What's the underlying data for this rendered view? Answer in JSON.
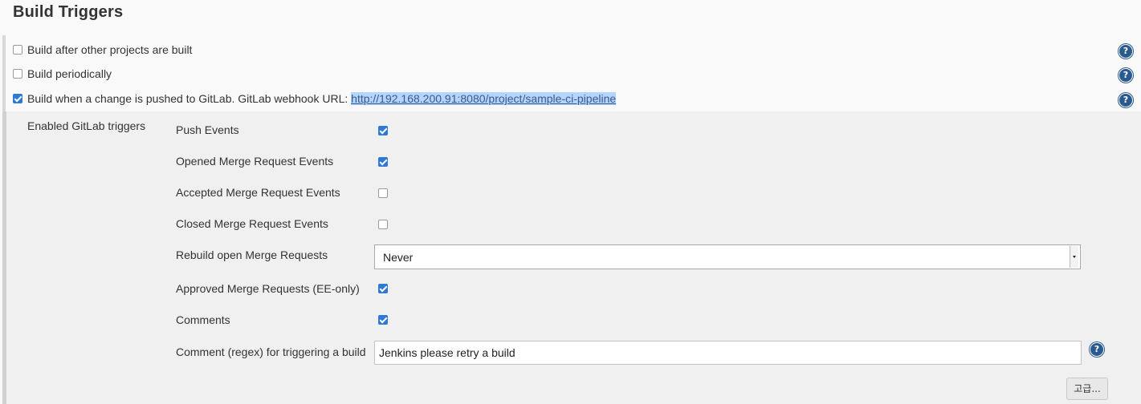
{
  "section": {
    "title": "Build Triggers"
  },
  "triggers": [
    {
      "label": "Build after other projects are built",
      "checked": false
    },
    {
      "label": "Build periodically",
      "checked": false
    },
    {
      "label": "Build when a change is pushed to GitLab. GitLab webhook URL: ",
      "url": "http://192.168.200.91:8080/project/sample-ci-pipeline",
      "checked": true
    }
  ],
  "help_icon": {
    "glyph": "?",
    "icon": "question-circle-icon",
    "color": "#2a5a8e"
  },
  "gitlab": {
    "group_label": "Enabled GitLab triggers",
    "options": [
      {
        "label": "Push Events",
        "checked": true
      },
      {
        "label": "Opened Merge Request Events",
        "checked": true
      },
      {
        "label": "Accepted Merge Request Events",
        "checked": false
      },
      {
        "label": "Closed Merge Request Events",
        "checked": false
      },
      {
        "label": "Rebuild open Merge Requests",
        "type": "select",
        "value": "Never"
      },
      {
        "label": "Approved Merge Requests (EE-only)",
        "checked": true
      },
      {
        "label": "Comments",
        "checked": true
      },
      {
        "label": "Comment (regex) for triggering a build",
        "type": "text",
        "value": "Jenkins please retry a build"
      }
    ],
    "advanced_button": "고급..."
  },
  "colors": {
    "checkbox_checked": "#2e78d6",
    "url_highlight": "#b4d5fe",
    "panel_background": "#f0f0f0"
  }
}
